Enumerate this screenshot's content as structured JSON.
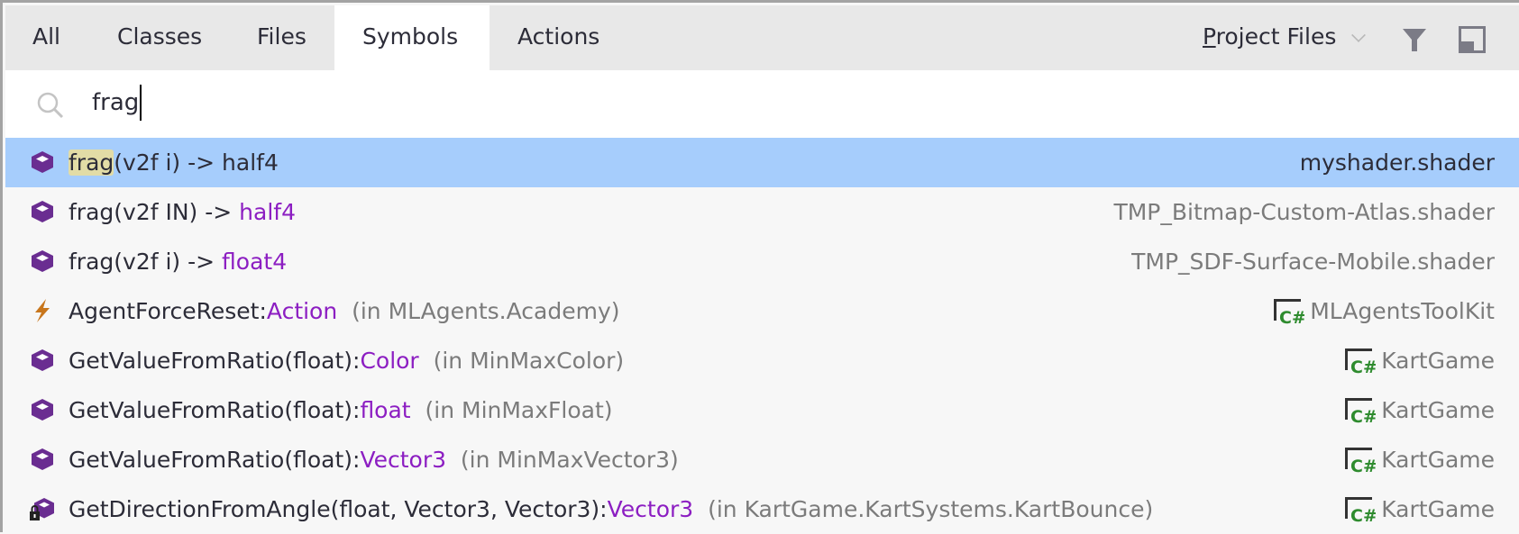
{
  "tabs": [
    {
      "label": "All",
      "active": false
    },
    {
      "label": "Classes",
      "active": false
    },
    {
      "label": "Files",
      "active": false
    },
    {
      "label": "Symbols",
      "active": true
    },
    {
      "label": "Actions",
      "active": false
    }
  ],
  "scope": {
    "mnemonic": "P",
    "rest": "roject Files",
    "icon": "chevron-down-icon"
  },
  "toolbar": {
    "filter_icon": "filter-icon",
    "window_icon": "pin-window-icon"
  },
  "search": {
    "value": "frag",
    "icon": "search-icon"
  },
  "colors": {
    "selected_row": "#a6cdfc",
    "match_highlight": "#e2dca6",
    "type": "#8c1ec2",
    "secondary": "#7b7b7b"
  },
  "results": [
    {
      "match": "frag",
      "name": "(v2f i) -> half4",
      "type": "",
      "context": "",
      "location": "myshader.shader",
      "icon": "method-icon",
      "selected": true
    },
    {
      "match": "",
      "name": "frag(v2f IN) -> ",
      "type": "half4",
      "context": "",
      "location": "TMP_Bitmap-Custom-Atlas.shader",
      "icon": "method-icon"
    },
    {
      "match": "",
      "name": "frag(v2f i) -> ",
      "type": "float4",
      "context": "",
      "location": "TMP_SDF-Surface-Mobile.shader",
      "icon": "method-icon"
    },
    {
      "match": "",
      "name": "AgentForceReset:",
      "type": "Action",
      "context": "  (in MLAgents.Academy)",
      "location": "MLAgentsToolKit",
      "icon": "event-icon",
      "project": true
    },
    {
      "match": "",
      "name": "GetValueFromRatio(float):",
      "type": "Color",
      "context": "  (in MinMaxColor)",
      "location": "KartGame",
      "icon": "method-icon",
      "project": true
    },
    {
      "match": "",
      "name": "GetValueFromRatio(float):",
      "type": "float",
      "context": "  (in MinMaxFloat)",
      "location": "KartGame",
      "icon": "method-icon",
      "project": true
    },
    {
      "match": "",
      "name": "GetValueFromRatio(float):",
      "type": "Vector3",
      "context": "  (in MinMaxVector3)",
      "location": "KartGame",
      "icon": "method-icon",
      "project": true
    },
    {
      "match": "",
      "name": "GetDirectionFromAngle(float, Vector3, Vector3):",
      "type": "Vector3",
      "context": "  (in KartGame.KartSystems.KartBounce)",
      "location": "KartGame",
      "icon": "private-method-icon",
      "project": true
    }
  ]
}
